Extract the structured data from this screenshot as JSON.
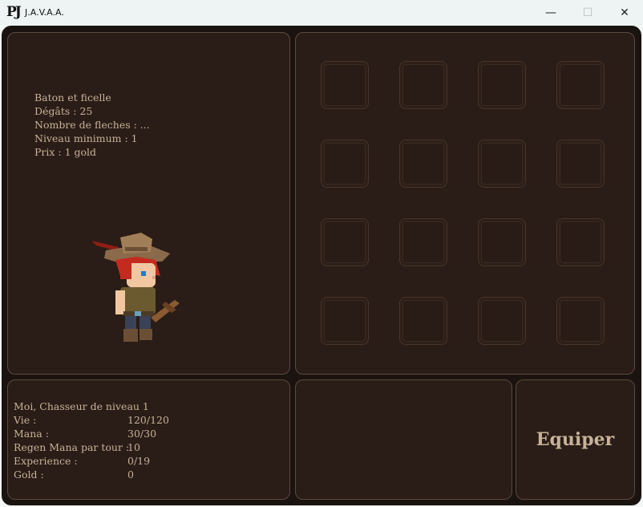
{
  "window": {
    "logo": "PJ",
    "title": "J.A.V.A.A.",
    "minimize_glyph": "—",
    "maximize_glyph": "☐",
    "close_glyph": "✕"
  },
  "item": {
    "name": "Baton et ficelle",
    "damage": "Dégâts : 25",
    "arrows": "Nombre de fleches : ...",
    "min_level": "Niveau minimum : 1",
    "price": "Prix : 1 gold"
  },
  "inventory": {
    "slot_count": 16
  },
  "stats": {
    "title": "Moi, Chasseur de niveau 1",
    "rows": [
      {
        "label": "Vie :",
        "value": "120/120"
      },
      {
        "label": "Mana :",
        "value": "30/30"
      },
      {
        "label": "Regen Mana par tour :",
        "value": "10"
      },
      {
        "label": "Experience :",
        "value": "0/19"
      },
      {
        "label": "Gold :",
        "value": "0"
      }
    ]
  },
  "actions": {
    "equip_label": "Equiper"
  },
  "colors": {
    "background": "#1a1310",
    "panel": "#2a1c16",
    "border": "#5c4a3e",
    "text": "#c7b29a"
  }
}
